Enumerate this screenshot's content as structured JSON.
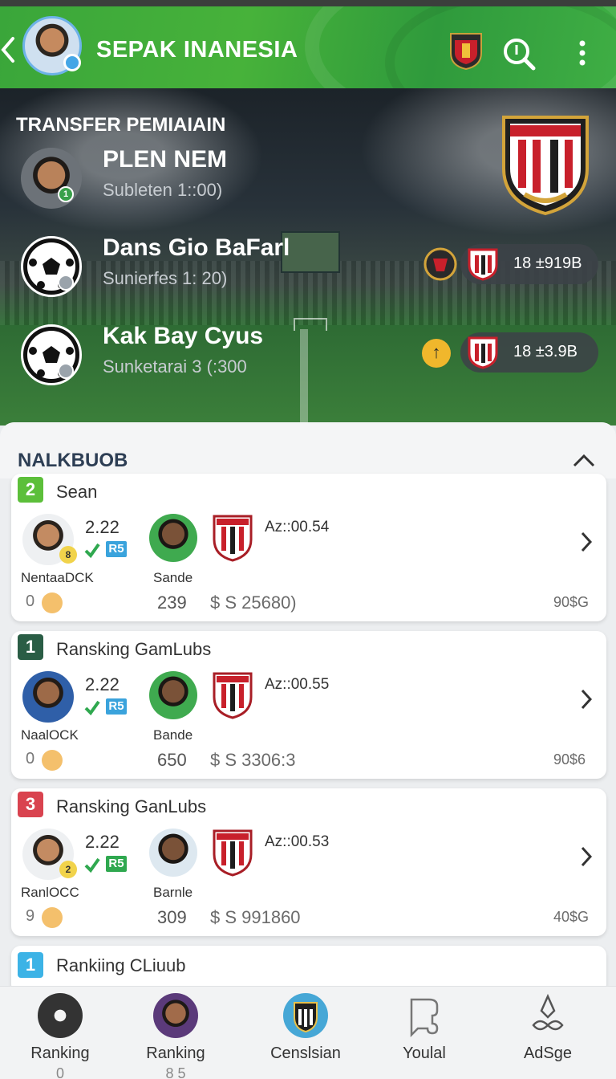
{
  "header": {
    "title": "SEPAK INANESIA",
    "back_icon": "chevron-left-icon",
    "search_icon": "search-icon",
    "more_icon": "more-vertical-icon"
  },
  "hero": {
    "title": "TRANSFER PEMIAIAIN",
    "transfers": [
      {
        "name": "PLEN NEM",
        "sub": "Subleten 1::00)",
        "badge": "1",
        "value": ""
      },
      {
        "name": "Dans Gio BaFarl",
        "sub": "Sunierfes 1: 20)",
        "badge": "",
        "value": "18 ±919B"
      },
      {
        "name": "Kak Bay Cyus",
        "sub": "Sunketarai 3 (:300",
        "badge": "",
        "value": "18 ±3.9B"
      }
    ]
  },
  "section": {
    "title": "NALKBUOB",
    "collapse_icon": "chevron-up-icon"
  },
  "cards": [
    {
      "rank": "2",
      "rank_color": "#5cbf3a",
      "title": "Sean",
      "score": "2.22",
      "flag": "R5",
      "player1": "NentaaDCK",
      "player2": "Sande",
      "time": "Az::00.54",
      "foot_n": "0",
      "foot_a": "239",
      "foot_b": "$ S 25680)",
      "foot_c": "90$G",
      "mini": "8"
    },
    {
      "rank": "1",
      "rank_color": "#2a5d45",
      "title": "Ransking GamLubs",
      "score": "2.22",
      "flag": "R5",
      "player1": "NaalOCK",
      "player2": "Bande",
      "time": "Az::00.55",
      "foot_n": "0",
      "foot_a": "650",
      "foot_b": "$ S 3306:3",
      "foot_c": "90$6",
      "mini": ""
    },
    {
      "rank": "3",
      "rank_color": "#d9434f",
      "title": "Ransking GanLubs",
      "score": "2.22",
      "flag": "R5",
      "player1": "RanlOCC",
      "player2": "Barnle",
      "time": "Az::00.53",
      "foot_n": "9",
      "foot_a": "309",
      "foot_b": "$ S 991860",
      "foot_c": "40$G",
      "mini": "2"
    },
    {
      "rank": "1",
      "rank_color": "#3cb3e6",
      "title": "Rankiing CLiuub"
    }
  ],
  "nav": [
    {
      "label": "Ranking",
      "sub": "0",
      "icon": "player-avatar-icon"
    },
    {
      "label": "Ranking",
      "sub": "8 5",
      "icon": "player-avatar-icon"
    },
    {
      "label": "Censlsian",
      "sub": "",
      "icon": "club-crest-icon"
    },
    {
      "label": "Youlal",
      "sub": "",
      "icon": "bookmark-icon"
    },
    {
      "label": "AdSge",
      "sub": "",
      "icon": "settings-link-icon"
    }
  ],
  "colors": {
    "header_green": "#3aa63a",
    "crest_red": "#c8202b"
  }
}
